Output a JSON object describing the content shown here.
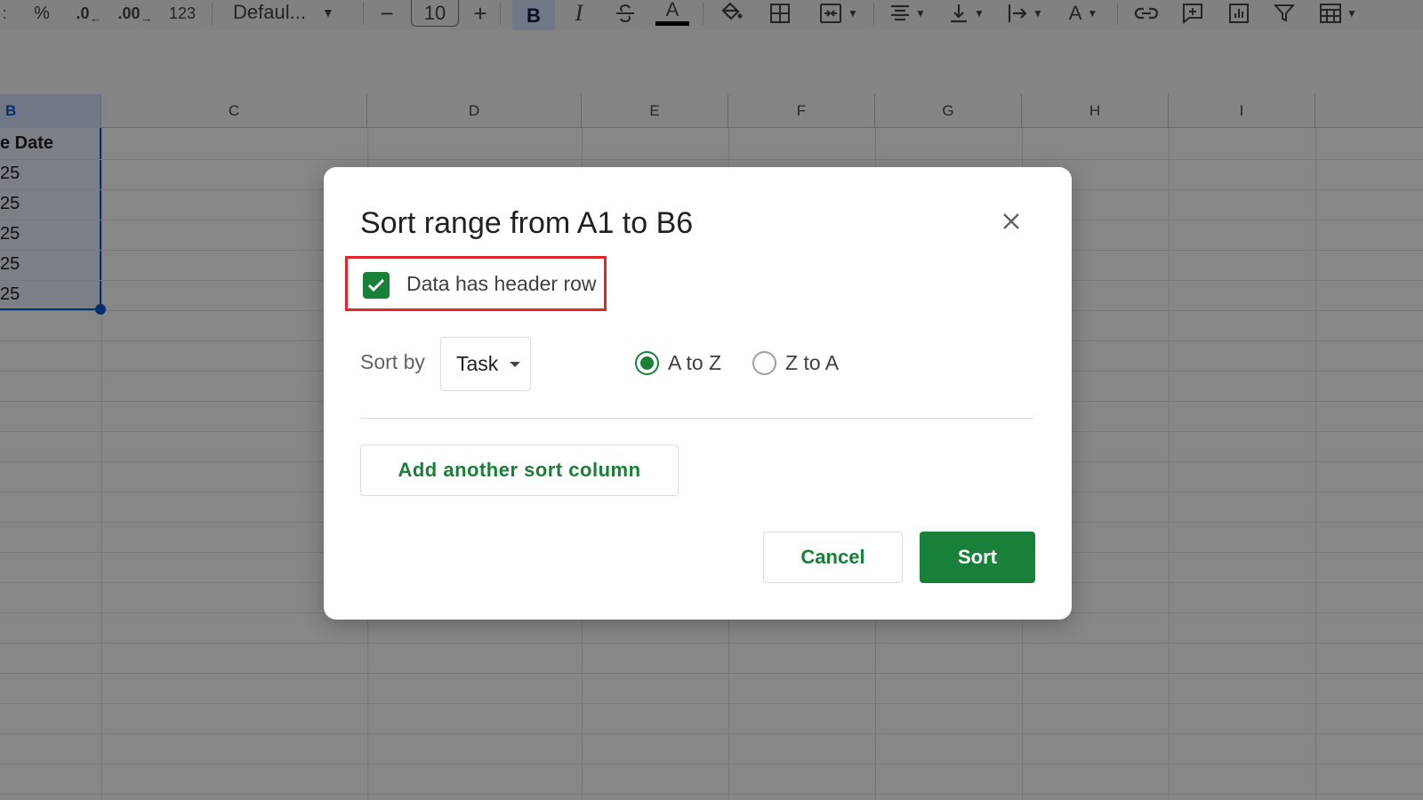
{
  "toolbar": {
    "percent": "%",
    "decrease_decimal": ".0",
    "increase_decimal": ".00",
    "number_format": "123",
    "font_name": "Defaul...",
    "font_size_minus": "−",
    "font_size": "10",
    "font_size_plus": "+",
    "bold": "B",
    "italic": "I",
    "text_color_letter": "A",
    "text_rotation_letter": "A"
  },
  "grid": {
    "columns": [
      "B",
      "C",
      "D",
      "E",
      "F",
      "G",
      "H",
      "I"
    ],
    "column_b_cells": [
      "e Date",
      "25",
      "25",
      "25",
      "25",
      "25"
    ]
  },
  "dialog": {
    "title": "Sort range from A1 to B6",
    "header_row_label": "Data has header row",
    "header_row_checked": true,
    "sort_by_label": "Sort by",
    "sort_by_value": "Task",
    "order_options": [
      "A to Z",
      "Z to A"
    ],
    "order_selected": "A to Z",
    "add_sort_column": "Add another sort column",
    "cancel": "Cancel",
    "sort": "Sort"
  },
  "colors": {
    "accent_green": "#188038",
    "highlight_red": "#e0252b",
    "selection_blue": "#0b57d0"
  }
}
